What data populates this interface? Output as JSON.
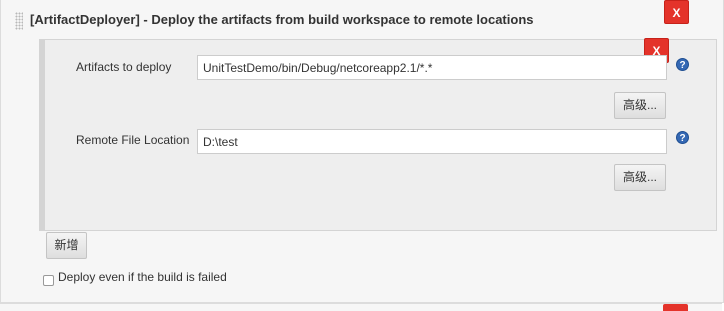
{
  "section": {
    "title": "[ArtifactDeployer] - Deploy the artifacts from build workspace to remote locations",
    "close_label": "X"
  },
  "entry": {
    "close_label": "X",
    "fields": [
      {
        "label": "Artifacts to deploy",
        "value": "UnitTestDemo/bin/Debug/netcoreapp2.1/*.*",
        "advanced_label": "高级..."
      },
      {
        "label": "Remote File Location",
        "value": "D:\\test",
        "advanced_label": "高级..."
      }
    ],
    "help_glyph": "?"
  },
  "add_button_label": "新增",
  "options": {
    "deploy_if_failed_label": "Deploy even if the build is failed",
    "deploy_if_failed_checked": false
  },
  "colors": {
    "close_red": "#e4332a",
    "help_blue": "#3468b4"
  }
}
